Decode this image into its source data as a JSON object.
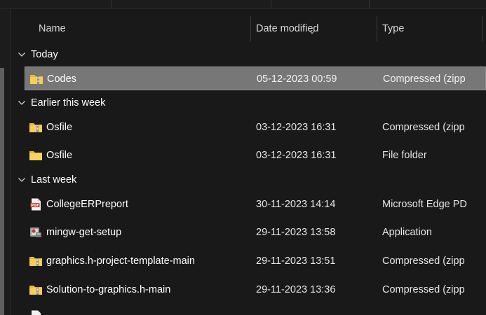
{
  "columns": {
    "name": "Name",
    "date_modified": "Date modified",
    "type": "Type"
  },
  "groups": [
    {
      "label": "Today"
    },
    {
      "label": "Earlier this week"
    },
    {
      "label": "Last week"
    }
  ],
  "files": [
    {
      "name": "Codes",
      "date": "05-12-2023 00:59",
      "type": "Compressed (zipp",
      "icon": "zip-folder-icon",
      "selected": true
    },
    {
      "name": "Osfile",
      "date": "03-12-2023 16:31",
      "type": "Compressed (zipp",
      "icon": "zip-folder-icon"
    },
    {
      "name": "Osfile",
      "date": "03-12-2023 16:31",
      "type": "File folder",
      "icon": "folder-icon"
    },
    {
      "name": "CollegeERPreport",
      "date": "30-11-2023 14:14",
      "type": "Microsoft Edge PD",
      "icon": "pdf-file-icon"
    },
    {
      "name": "mingw-get-setup",
      "date": "29-11-2023 13:58",
      "type": "Application",
      "icon": "installer-app-icon"
    },
    {
      "name": "graphics.h-project-template-main",
      "date": "29-11-2023 13:51",
      "type": "Compressed (zipp",
      "icon": "zip-folder-icon"
    },
    {
      "name": "Solution-to-graphics.h-main",
      "date": "29-11-2023 13:36",
      "type": "Compressed (zipp",
      "icon": "zip-folder-icon"
    }
  ],
  "colors": {
    "background": "#191919",
    "selection": "#777777",
    "folder_yellow": "#f4c64b",
    "pdf_red": "#d83a2c"
  }
}
